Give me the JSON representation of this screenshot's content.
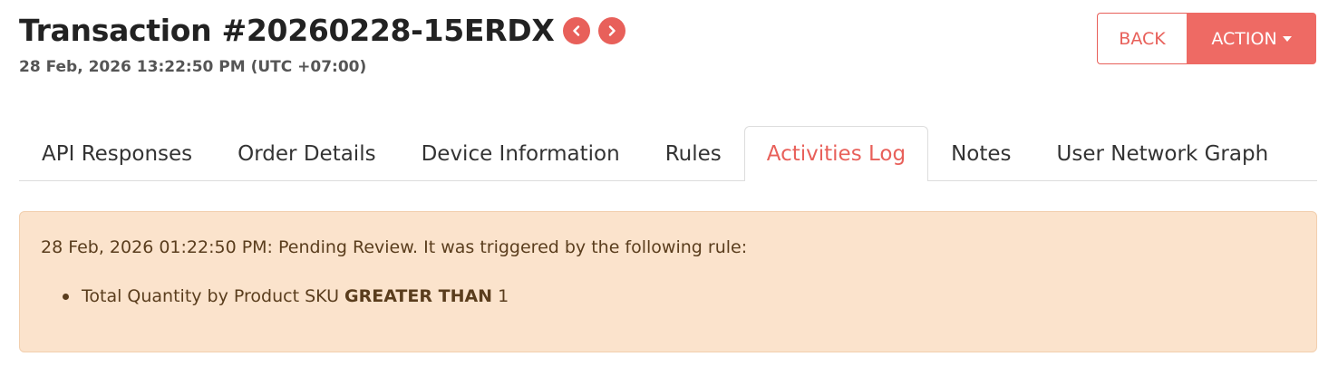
{
  "header": {
    "title": "Transaction #20260228-15ERDX",
    "timestamp": "28 Feb, 2026 13:22:50 PM (UTC +07:00)",
    "prev_icon": "chevron-left-icon",
    "next_icon": "chevron-right-icon"
  },
  "actions": {
    "back_label": "BACK",
    "action_label": "ACTION"
  },
  "tabs": [
    {
      "label": "API Responses",
      "active": false
    },
    {
      "label": "Order Details",
      "active": false
    },
    {
      "label": "Device Information",
      "active": false
    },
    {
      "label": "Rules",
      "active": false
    },
    {
      "label": "Activities Log",
      "active": true
    },
    {
      "label": "Notes",
      "active": false
    },
    {
      "label": "User Network Graph",
      "active": false
    }
  ],
  "activity": {
    "message": "28 Feb, 2026 01:22:50 PM: Pending Review. It was triggered by the following rule:",
    "rule": {
      "field": "Total Quantity by Product SKU",
      "operator": "GREATER THAN",
      "value": "1"
    }
  },
  "colors": {
    "accent": "#e8605a",
    "alert_bg": "#fbe3cc",
    "alert_text": "#5a3d1d"
  }
}
